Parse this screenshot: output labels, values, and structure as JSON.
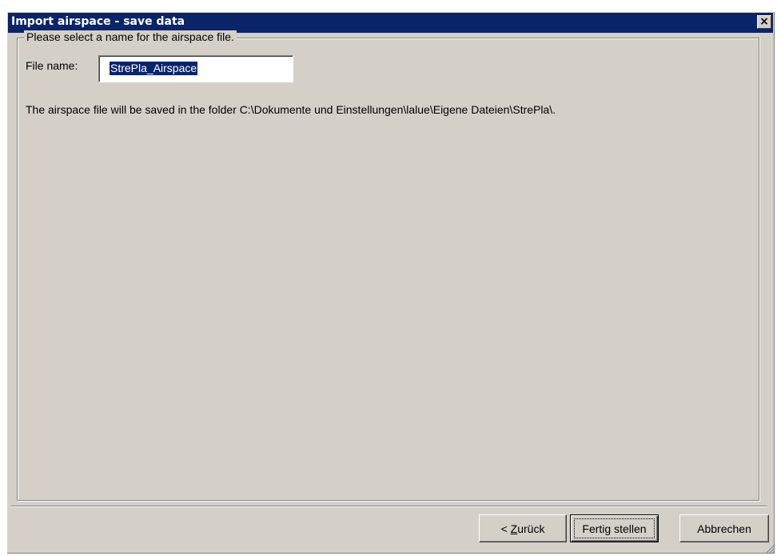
{
  "window": {
    "title": "Import airspace - save data",
    "close_glyph": "×"
  },
  "group": {
    "legend": "Please select a name for the airspace file."
  },
  "file_name": {
    "label": "File name:",
    "value": "StrePla_Airspace"
  },
  "info_text": "The airspace file will be saved in the folder C:\\Dokumente und Einstellungen\\lalue\\Eigene Dateien\\StrePla\\.",
  "buttons": {
    "back": {
      "prefix": "< ",
      "mnemonic": "Z",
      "rest": "urück"
    },
    "finish": "Fertig stellen",
    "cancel": "Abbrechen"
  },
  "colors": {
    "titlebar": "#0a246a",
    "face": "#d4d0c8",
    "selection": "#0a246a"
  }
}
